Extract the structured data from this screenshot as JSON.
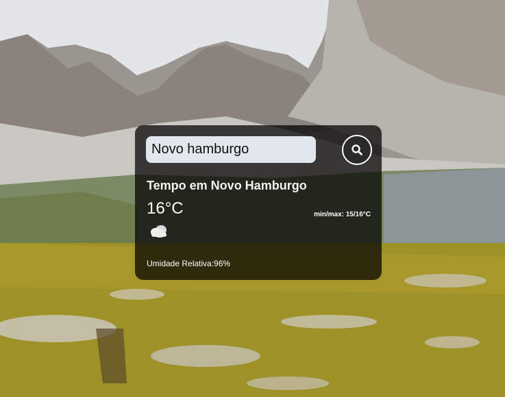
{
  "search": {
    "value": "Novo hamburgo",
    "placeholder": "",
    "button_icon": "search-icon"
  },
  "weather": {
    "title": "Tempo em Novo Hamburgo",
    "temperature": "16°C",
    "minmax": "min/max: 15/16°C",
    "condition_icon": "cloudy-icon",
    "humidity": "Umidade Relativa:96%"
  },
  "colors": {
    "card_background": "#000000b8",
    "text": "#ffffff",
    "input_background": "#ebf0f8"
  }
}
